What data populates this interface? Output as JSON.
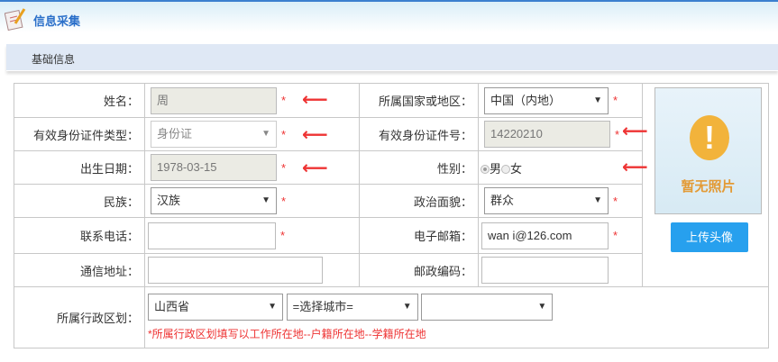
{
  "header": {
    "title": "信息采集",
    "icon": "form-edit-icon"
  },
  "section": {
    "title": "基础信息"
  },
  "form": {
    "name": {
      "label": "姓名：",
      "value": "周"
    },
    "country": {
      "label": "所属国家或地区：",
      "value": "中国（内地）"
    },
    "id_type": {
      "label": "有效身份证件类型：",
      "value": "身份证"
    },
    "id_number": {
      "label": "有效身份证件号：",
      "value": "14220210"
    },
    "birth": {
      "label": "出生日期：",
      "value": "1978-03-15"
    },
    "gender": {
      "label": "性别：",
      "male": "男",
      "female": "女",
      "selected": "男"
    },
    "ethnicity": {
      "label": "民族：",
      "value": "汉族"
    },
    "politics": {
      "label": "政治面貌：",
      "value": "群众"
    },
    "phone": {
      "label": "联系电话：",
      "value": ""
    },
    "email": {
      "label": "电子邮箱：",
      "value": "wan     i@126.com"
    },
    "address": {
      "label": "通信地址：",
      "value": ""
    },
    "postcode": {
      "label": "邮政编码：",
      "value": ""
    },
    "region": {
      "label": "所属行政区划：",
      "province": "山西省",
      "city": "=选择城市=",
      "district": "",
      "hint": "*所属行政区划填写以工作所在地--户籍所在地--学籍所在地"
    },
    "required_mark": "*"
  },
  "photo": {
    "placeholder": "暂无照片",
    "upload_label": "上传头像"
  },
  "colors": {
    "accent": "#27a0ee",
    "required": "#ee3333"
  }
}
